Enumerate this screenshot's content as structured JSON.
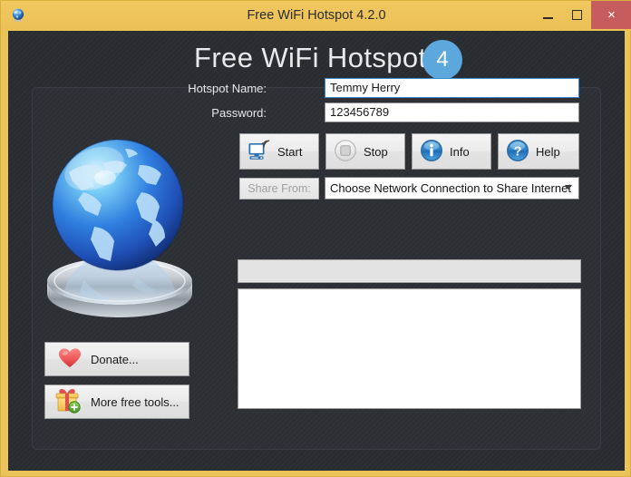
{
  "window": {
    "title": "Free WiFi Hotspot 4.2.0",
    "app_icon": "globe-icon",
    "frame_color": "#eac459",
    "close_color": "#c75c5c",
    "controls": {
      "minimize": "minimize-icon",
      "maximize": "maximize-icon",
      "close": "×"
    }
  },
  "header": {
    "title": "Free WiFi Hotspot",
    "badge": "4",
    "badge_color": "#5ca8dc",
    "background_color": "#292c31"
  },
  "artwork": {
    "globe": "globe-on-pedestal-illustration"
  },
  "form": {
    "hotspot_name_label": "Hotspot Name:",
    "hotspot_name_value": "Temmy Herry",
    "hotspot_name_placeholder": "Hotspot Name",
    "password_label": "Password:",
    "password_value": "123456789",
    "password_placeholder": "Password",
    "focus_border_color": "#3c87c9"
  },
  "actions": [
    {
      "label": "Start",
      "icon": "monitor-wifi-icon",
      "enabled": true
    },
    {
      "label": "Stop",
      "icon": "stop-circle-icon",
      "enabled": false
    },
    {
      "label": "Info",
      "icon": "info-circle-icon",
      "enabled": true
    },
    {
      "label": "Help",
      "icon": "help-circle-icon",
      "enabled": true
    }
  ],
  "share": {
    "button_label": "Share From:",
    "button_enabled": false,
    "dropdown_value": "Choose Network Connection to Share Internet",
    "dropdown_icon": "chevron-down-icon"
  },
  "list": {
    "header_text": "",
    "rows": []
  },
  "side_buttons": [
    {
      "label": "Donate...",
      "icon": "heart-icon"
    },
    {
      "label": "More free tools...",
      "icon": "gift-icon"
    }
  ]
}
